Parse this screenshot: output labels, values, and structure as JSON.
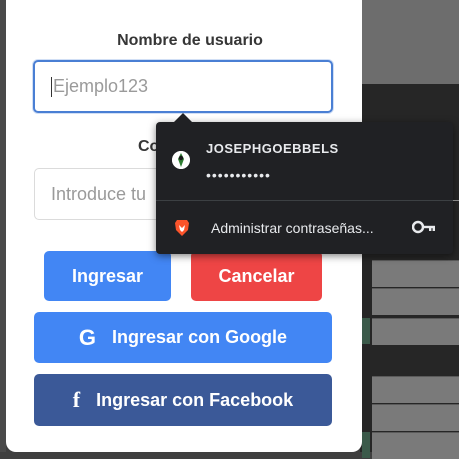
{
  "login": {
    "username_label": "Nombre de usuario",
    "username_placeholder": "Ejemplo123",
    "password_label_visible": "Co",
    "password_placeholder_visible": "Introduce tu",
    "login_button": "Ingresar",
    "cancel_button": "Cancelar",
    "google_button": "Ingresar con Google",
    "facebook_button": "Ingresar con Facebook"
  },
  "password_popup": {
    "username": "JOSEPHGOEBBELS",
    "password_mask": "•••••••••••",
    "manage_label": "Administrar contraseñas..."
  },
  "icons": {
    "google": "google-icon",
    "facebook": "facebook-icon",
    "brave": "brave-lion-icon",
    "key": "key-icon",
    "avatar": "site-avatar-icon"
  },
  "colors": {
    "primary": "#4286f4",
    "danger": "#ee4545",
    "facebook": "#3b5998",
    "popup_bg": "#202124",
    "brave_orange": "#fb542b"
  }
}
